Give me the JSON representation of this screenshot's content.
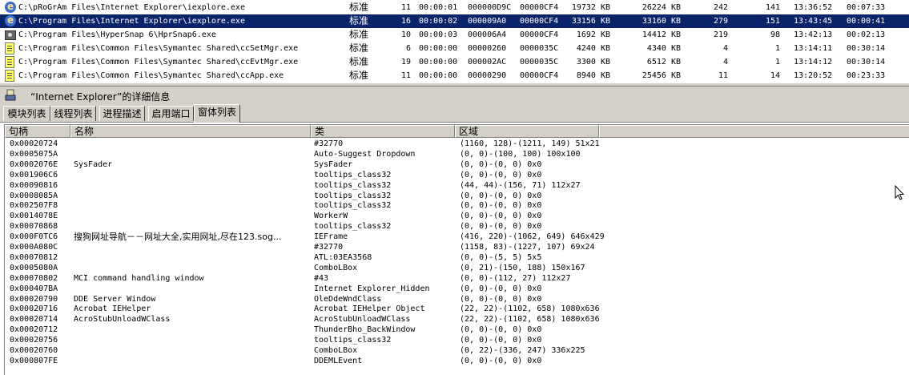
{
  "processes": [
    {
      "icon": "ie-icon",
      "path": "C:\\pRoGrAm Files\\Internet Explorer\\iexplore.exe",
      "priority": "标准",
      "threads": "11",
      "cpu_time": "00:00:01",
      "pid": "000000D9C",
      "ppid": "00000CF4",
      "mem": "19732 KB",
      "vm": "26224 KB",
      "handles": "242",
      "gdi": "141",
      "start": "13:36:52",
      "elapsed": "00:07:33",
      "selected": false
    },
    {
      "icon": "ie-icon",
      "path": "C:\\Program Files\\Internet Explorer\\iexplore.exe",
      "priority": "标准",
      "threads": "16",
      "cpu_time": "00:00:02",
      "pid": "000009A0",
      "ppid": "00000CF4",
      "mem": "33156 KB",
      "vm": "33160 KB",
      "handles": "279",
      "gdi": "151",
      "start": "13:43:45",
      "elapsed": "00:00:41",
      "selected": true
    },
    {
      "icon": "camera-icon",
      "path": "C:\\Program Files\\HyperSnap 6\\HprSnap6.exe",
      "priority": "标准",
      "threads": "10",
      "cpu_time": "00:00:03",
      "pid": "000006A4",
      "ppid": "00000CF4",
      "mem": "1692 KB",
      "vm": "14412 KB",
      "handles": "219",
      "gdi": "98",
      "start": "13:42:13",
      "elapsed": "00:02:13",
      "selected": false
    },
    {
      "icon": "document-icon",
      "path": "C:\\Program Files\\Common Files\\Symantec Shared\\ccSetMgr.exe",
      "priority": "标准",
      "threads": "6",
      "cpu_time": "00:00:00",
      "pid": "00000260",
      "ppid": "0000035C",
      "mem": "4240 KB",
      "vm": "4340 KB",
      "handles": "4",
      "gdi": "1",
      "start": "13:14:11",
      "elapsed": "00:30:14",
      "selected": false
    },
    {
      "icon": "document-icon",
      "path": "C:\\Program Files\\Common Files\\Symantec Shared\\ccEvtMgr.exe",
      "priority": "标准",
      "threads": "19",
      "cpu_time": "00:00:00",
      "pid": "000002AC",
      "ppid": "0000035C",
      "mem": "3300 KB",
      "vm": "6512 KB",
      "handles": "4",
      "gdi": "1",
      "start": "13:14:12",
      "elapsed": "00:30:14",
      "selected": false
    },
    {
      "icon": "document-icon",
      "path": "C:\\Program Files\\Common Files\\Symantec Shared\\ccApp.exe",
      "priority": "标准",
      "threads": "11",
      "cpu_time": "00:00:00",
      "pid": "00000290",
      "ppid": "00000CF4",
      "mem": "8940 KB",
      "vm": "25456 KB",
      "handles": "11",
      "gdi": "14",
      "start": "13:20:52",
      "elapsed": "00:23:33",
      "selected": false
    }
  ],
  "details_title": "“Internet Explorer”的详细信息",
  "tabs": [
    {
      "label": "模块列表",
      "active": false
    },
    {
      "label": "线程列表",
      "active": false
    },
    {
      "label": "进程描述",
      "active": false
    },
    {
      "label": "启用端口",
      "active": false
    },
    {
      "label": "窗体列表",
      "active": true
    }
  ],
  "window_list": {
    "columns": [
      "句柄",
      "名称",
      "类",
      "区域"
    ],
    "rows": [
      {
        "handle": "0x00020724",
        "name": "",
        "class": "#32770",
        "region": "(1160, 128)-(1211, 149) 51x21"
      },
      {
        "handle": "0x0005075A",
        "name": "",
        "class": "Auto-Suggest Dropdown",
        "region": "(0, 0)-(100, 100) 100x100"
      },
      {
        "handle": "0x0002076E",
        "name": "SysFader",
        "class": "SysFader",
        "region": "(0, 0)-(0, 0) 0x0"
      },
      {
        "handle": "0x001906C6",
        "name": "",
        "class": "tooltips_class32",
        "region": "(0, 0)-(0, 0) 0x0"
      },
      {
        "handle": "0x00090816",
        "name": "",
        "class": "tooltips_class32",
        "region": "(44, 44)-(156, 71) 112x27"
      },
      {
        "handle": "0x0008085A",
        "name": "",
        "class": "tooltips_class32",
        "region": "(0, 0)-(0, 0) 0x0"
      },
      {
        "handle": "0x002507F8",
        "name": "",
        "class": "tooltips_class32",
        "region": "(0, 0)-(0, 0) 0x0"
      },
      {
        "handle": "0x0014078E",
        "name": "",
        "class": "WorkerW",
        "region": "(0, 0)-(0, 0) 0x0"
      },
      {
        "handle": "0x00070868",
        "name": "",
        "class": "tooltips_class32",
        "region": "(0, 0)-(0, 0) 0x0"
      },
      {
        "handle": "0x000F0TC6",
        "name": "搜狗网址导航－－网址大全,实用网址,尽在123.sog...",
        "class": "IEFrame",
        "region": "(416, 220)-(1062, 649) 646x429"
      },
      {
        "handle": "0x000A080C",
        "name": "",
        "class": "#32770",
        "region": "(1158, 83)-(1227, 107) 69x24"
      },
      {
        "handle": "0x00070812",
        "name": "",
        "class": "ATL:03EA3568",
        "region": "(0, 0)-(5, 5) 5x5"
      },
      {
        "handle": "0x0005080A",
        "name": "",
        "class": "ComboLBox",
        "region": "(0, 21)-(150, 188) 150x167"
      },
      {
        "handle": "0x00070802",
        "name": "MCI command handling window",
        "class": "#43",
        "region": "(0, 0)-(112, 27) 112x27"
      },
      {
        "handle": "0x000407BA",
        "name": "",
        "class": "Internet Explorer_Hidden",
        "region": "(0, 0)-(0, 0) 0x0"
      },
      {
        "handle": "0x00020790",
        "name": "DDE Server Window",
        "class": "OleDdeWndClass",
        "region": "(0, 0)-(0, 0) 0x0"
      },
      {
        "handle": "0x00020716",
        "name": "Acrobat IEHelper",
        "class": "Acrobat IEHelper Object",
        "region": "(22, 22)-(1102, 658) 1080x636"
      },
      {
        "handle": "0x00020714",
        "name": "AcroStubUnloadWClass",
        "class": "AcroStubUnloadWClass",
        "region": "(22, 22)-(1102, 658) 1080x636"
      },
      {
        "handle": "0x00020712",
        "name": "",
        "class": "ThunderBho_BackWindow",
        "region": "(0, 0)-(0, 0) 0x0"
      },
      {
        "handle": "0x00020756",
        "name": "",
        "class": "tooltips_class32",
        "region": "(0, 0)-(0, 0) 0x0"
      },
      {
        "handle": "0x00020760",
        "name": "",
        "class": "ComboLBox",
        "region": "(0, 22)-(336, 247) 336x225"
      },
      {
        "handle": "0x000807FE",
        "name": "",
        "class": "DDEMLEvent",
        "region": "(0, 0)-(0, 0) 0x0"
      }
    ]
  },
  "colors": {
    "selection": "#0a246a",
    "chrome": "#d4d0c8"
  }
}
